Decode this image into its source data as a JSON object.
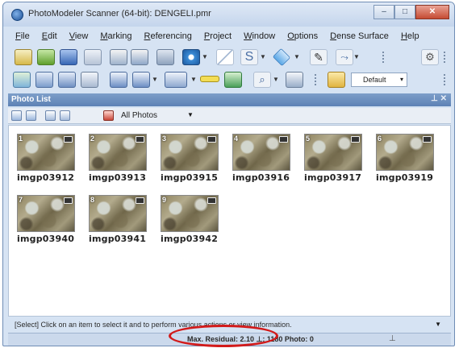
{
  "window": {
    "title": "PhotoModeler Scanner (64-bit): DENGELI.pmr",
    "controls": {
      "minimize": "–",
      "maximize": "□",
      "close": "✕"
    }
  },
  "menu": [
    "File",
    "Edit",
    "View",
    "Marking",
    "Referencing",
    "Project",
    "Window",
    "Options",
    "Dense Surface",
    "Help"
  ],
  "toolbar": {
    "row1_icons": [
      "open-icon",
      "import-icon",
      "save-icon",
      "undo-icon",
      "mark-point-icon",
      "mark-line-icon",
      "surface-icon",
      "coded-target-icon",
      "edge-icon",
      "curve-icon",
      "shape-icon",
      "pencil-icon",
      "process-icon"
    ],
    "row2_icons": [
      "photo-view-icon",
      "3d-view-icon",
      "table-view-icon",
      "text-icon",
      "open-window-icon",
      "viewer-icon",
      "tile-icon",
      "ruler-icon",
      "chart-icon",
      "zoom-icon",
      "grid-icon",
      "folder-icon"
    ],
    "style_combo": "Default"
  },
  "photo_list": {
    "pane_title": "Photo List",
    "pane_close": "⊥ ✕",
    "filter_label": "All Photos",
    "photos": [
      {
        "num": "1",
        "name": "imgp03912"
      },
      {
        "num": "2",
        "name": "imgp03913"
      },
      {
        "num": "3",
        "name": "imgp03915"
      },
      {
        "num": "4",
        "name": "imgp03916"
      },
      {
        "num": "5",
        "name": "imgp03917"
      },
      {
        "num": "6",
        "name": "imgp03919"
      },
      {
        "num": "7",
        "name": "imgp03940"
      },
      {
        "num": "8",
        "name": "imgp03941"
      },
      {
        "num": "9",
        "name": "imgp03942"
      }
    ]
  },
  "status": {
    "message": "[Select] Click on an item to select it and to perform various actions or view information.",
    "bar_text": "Max. Residual: 2.10 ⊥: 1180 Photo: 0"
  },
  "colors": {
    "highlight": "#d21a1a",
    "pane_header": "#5d82b5"
  }
}
